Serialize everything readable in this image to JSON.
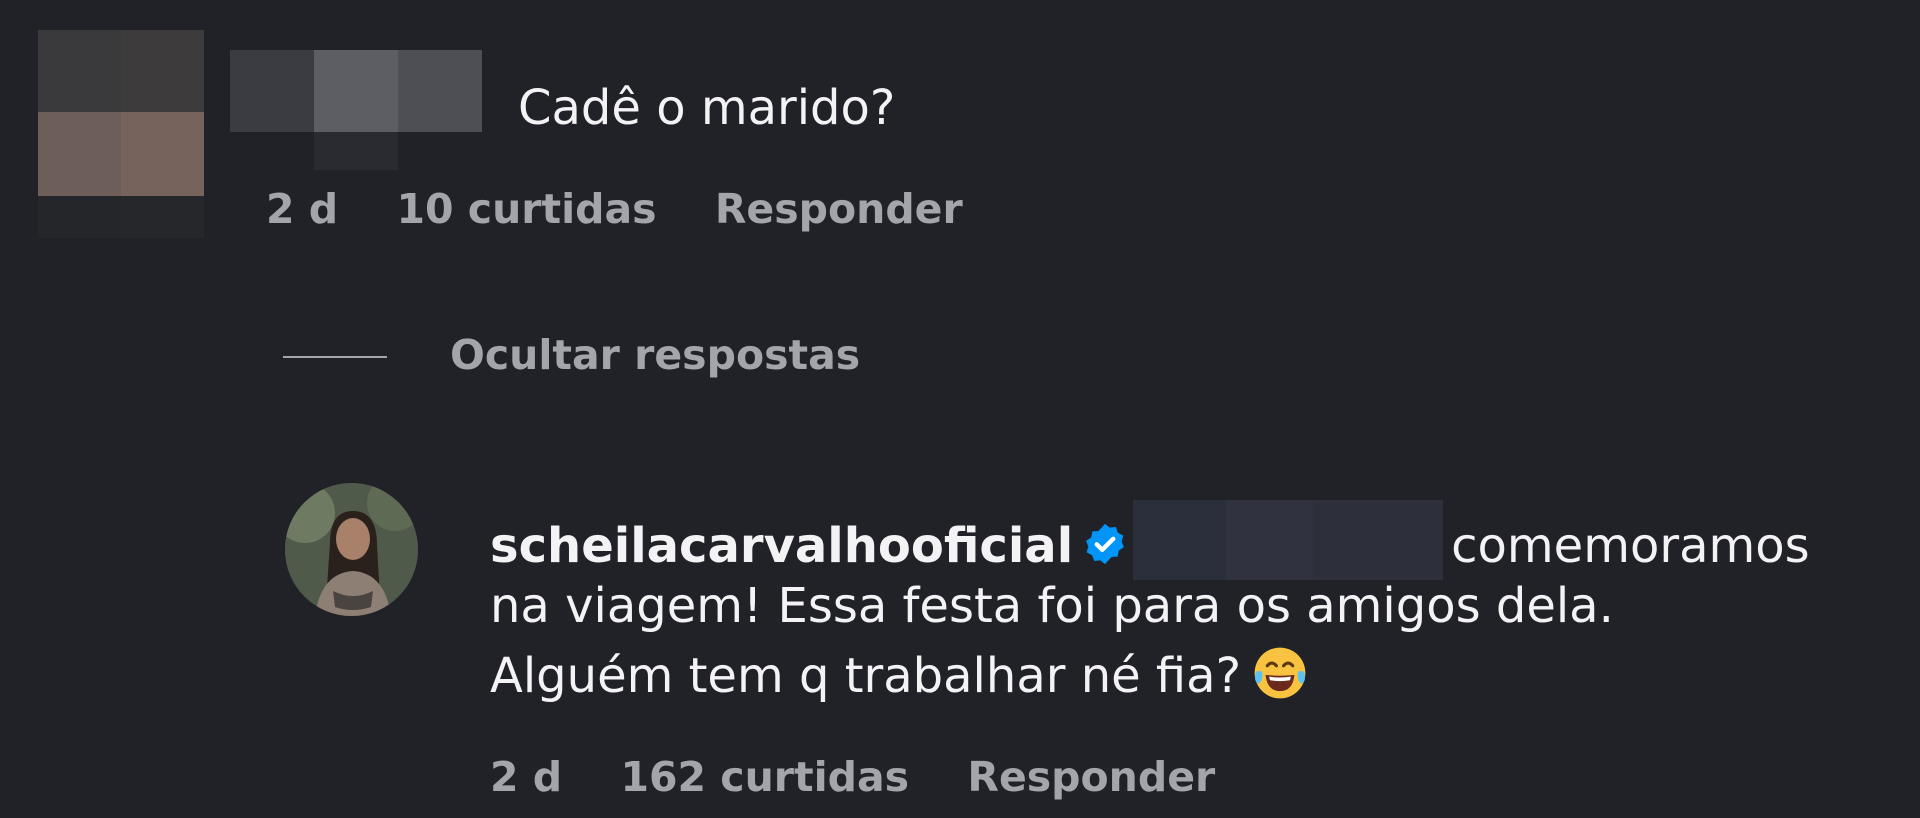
{
  "comment": {
    "text": "Cadê o marido?",
    "time": "2 d",
    "likes": "10 curtidas",
    "reply_label": "Responder"
  },
  "replies_toggle": {
    "label": "Ocultar respostas"
  },
  "reply": {
    "username": "scheilacarvalhooficial",
    "text_line1": "comemoramos",
    "text_line2": "na viagem! Essa festa foi para os amigos dela.",
    "text_line3": "Alguém tem q trabalhar né fia?",
    "time": "2 d",
    "likes": "162 curtidas",
    "reply_label": "Responder"
  },
  "colors": {
    "background": "#212227",
    "text": "#f3f3f5",
    "muted": "#a3a5ab",
    "verified": "#0095f6"
  },
  "icons": {
    "verified": "verified-badge-icon",
    "emoji": "tears-of-joy-emoji"
  }
}
